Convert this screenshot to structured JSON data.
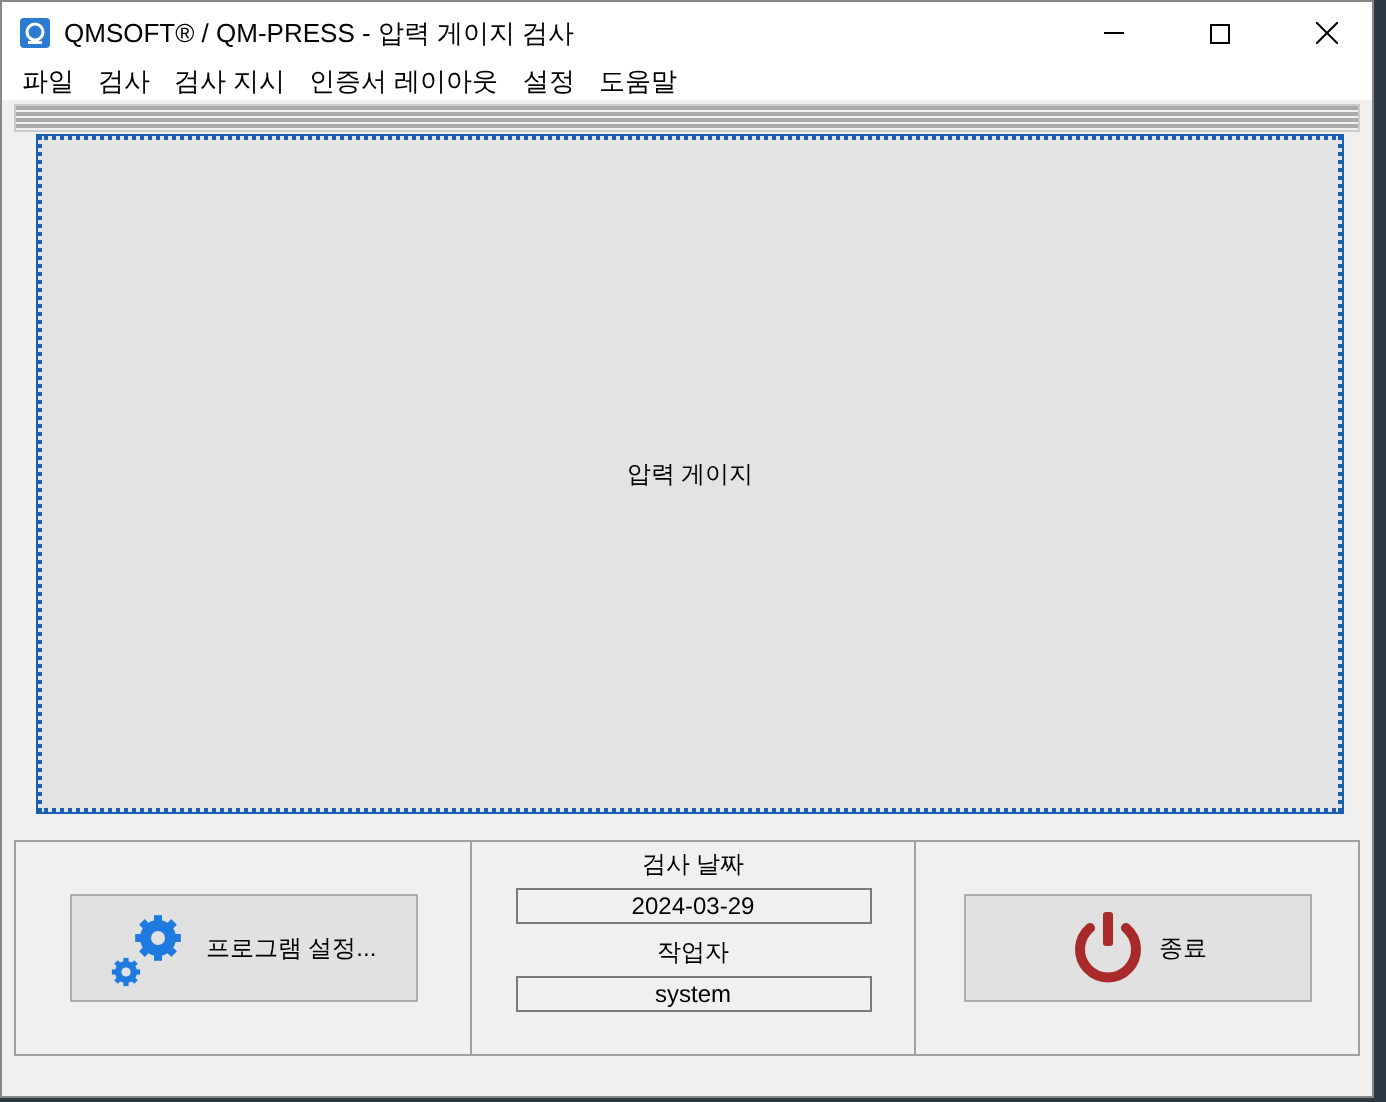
{
  "window": {
    "title": "QMSOFT® / QM-PRESS - 압력 게이지 검사"
  },
  "menu": [
    "파일",
    "검사",
    "검사 지시",
    "인증서 레이아웃",
    "설정",
    "도움말"
  ],
  "gauge_panel": {
    "label": "압력 게이지"
  },
  "settings_button": {
    "label": "프로그램 설정..."
  },
  "inspection_date": {
    "label": "검사 날짜",
    "value": "2024-03-29"
  },
  "operator": {
    "label": "작업자",
    "value": "system"
  },
  "exit_button": {
    "label": "종료"
  }
}
